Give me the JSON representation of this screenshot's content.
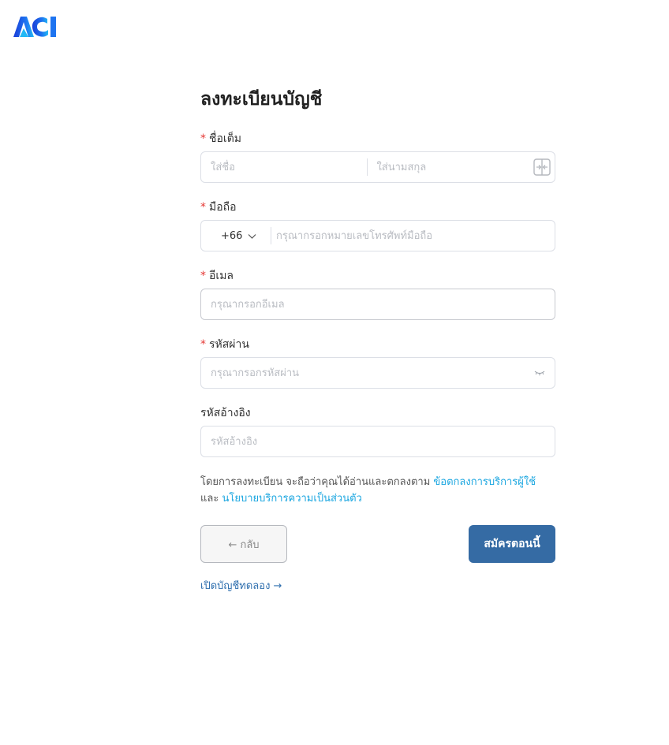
{
  "logo": {
    "text": "ACI"
  },
  "page_title": "ลงทะเบียนบัญชี",
  "fields": {
    "fullname": {
      "label": "ชื่อเต็ม",
      "required": "*",
      "first_placeholder": "ใส่ชื่อ",
      "last_placeholder": "ใส่นามสกุล",
      "first_value": "",
      "last_value": ""
    },
    "mobile": {
      "label": "มือถือ",
      "required": "*",
      "country_code": "+66",
      "placeholder": "กรุณากรอกหมายเลขโทรศัพท์มือถือ",
      "value": ""
    },
    "email": {
      "label": "อีเมล",
      "required": "*",
      "placeholder": "กรุณากรอกอีเมล",
      "value": ""
    },
    "password": {
      "label": "รหัสผ่าน",
      "required": "*",
      "placeholder": "กรุณากรอกรหัสผ่าน",
      "value": ""
    },
    "referral": {
      "label": "รหัสอ้างอิง",
      "placeholder": "รหัสอ้างอิง",
      "value": ""
    }
  },
  "terms": {
    "prefix": "โดยการลงทะเบียน จะถือว่าคุณได้อ่านและตกลงตาม ",
    "terms_link": "ข้อตกลงการบริการผู้ใช้",
    "and": "และ ",
    "privacy_link": "นโยบายบริการความเป็นส่วนตัว"
  },
  "buttons": {
    "back": "← กลับ",
    "submit": "สมัครตอนนี้"
  },
  "trial_link": "เปิดบัญชีทดลอง →",
  "icons": {
    "swap": "swap-icon",
    "chevron": "chevron-down-icon",
    "eye": "eye-closed-icon"
  },
  "colors": {
    "primary": "#356ba4",
    "link": "#1aa6e0",
    "required": "#e53935",
    "trial_link": "#2f6fae"
  }
}
